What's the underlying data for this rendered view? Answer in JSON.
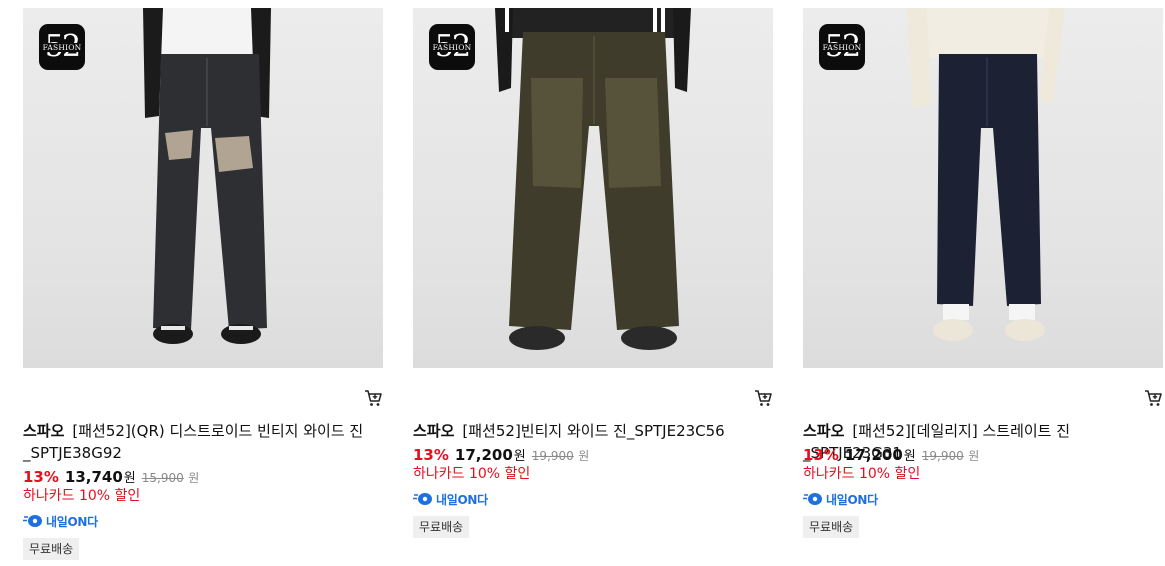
{
  "products": [
    {
      "brand": "스파오",
      "name_line1": "[패션52](QR) 디스트로이드 빈티지 와이드 진",
      "name_line2": "_SPTJE38G92",
      "discount_rate": "13%",
      "price": "13,740",
      "currency": "원",
      "original_price": "15,900",
      "original_currency": "원",
      "card_discount": "하나카드 10% 할인",
      "delivery_label": "내일ON다",
      "free_shipping": "무료배송",
      "badge_number": "52",
      "badge_word": "FASHION",
      "jeans_color": "#2e2f33"
    },
    {
      "brand": "스파오",
      "name_line1": "[패션52]빈티지 와이드 진_SPTJE23C56",
      "name_line2": "",
      "discount_rate": "13%",
      "price": "17,200",
      "currency": "원",
      "original_price": "19,900",
      "original_currency": "원",
      "card_discount": "하나카드 10% 할인",
      "delivery_label": "내일ON다",
      "free_shipping": "무료배송",
      "badge_number": "52",
      "badge_word": "FASHION",
      "jeans_color": "#3f3c2c"
    },
    {
      "brand": "스파오",
      "name_line1": "[패션52][데일리지] 스트레이트 진_SPTJE23G31",
      "name_line2": "",
      "discount_rate": "13%",
      "price": "17,200",
      "currency": "원",
      "original_price": "19,900",
      "original_currency": "원",
      "card_discount": "하나카드 10% 할인",
      "delivery_label": "내일ON다",
      "free_shipping": "무료배송",
      "badge_number": "52",
      "badge_word": "FASHION",
      "jeans_color": "#1c2233"
    }
  ],
  "colors": {
    "discount_red": "#e1111f",
    "delivery_blue": "#1e6fe0",
    "chip_bg": "#efefef"
  },
  "icons": [
    "cart-icon",
    "delivery-truck-icon",
    "fashion52-badge"
  ]
}
